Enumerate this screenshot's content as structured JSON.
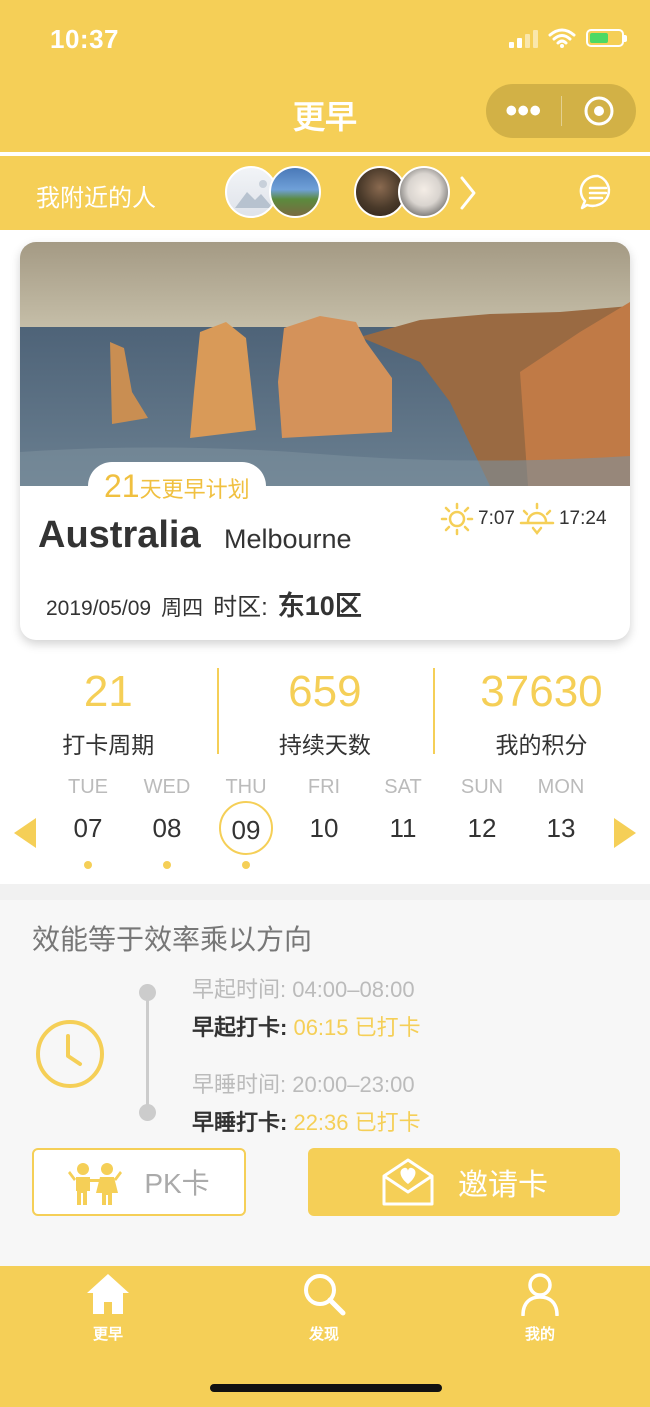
{
  "status": {
    "time": "10:37",
    "icons": [
      "signal-icon",
      "wifi-icon",
      "battery-charging-icon"
    ]
  },
  "nav": {
    "title": "更早",
    "capsule_more": "•••",
    "capsule_close_icon": "target-icon"
  },
  "nearby": {
    "label": "我附近的人"
  },
  "card": {
    "plan_number": "21",
    "plan_text": "天更早计划",
    "country": "Australia",
    "city": "Melbourne",
    "sunrise": "7:07",
    "sunset": "17:24",
    "date": "2019/05/09",
    "weekday": "周四",
    "tz_label": "时区:",
    "tz": "东10区"
  },
  "stats": [
    {
      "value": "21",
      "label": "打卡周期"
    },
    {
      "value": "659",
      "label": "持续天数"
    },
    {
      "value": "37630",
      "label": "我的积分"
    }
  ],
  "week": [
    {
      "name": "TUE",
      "num": "07",
      "dot": true,
      "selected": false
    },
    {
      "name": "WED",
      "num": "08",
      "dot": true,
      "selected": false
    },
    {
      "name": "THU",
      "num": "09",
      "dot": true,
      "selected": true
    },
    {
      "name": "FRI",
      "num": "10",
      "dot": false,
      "selected": false
    },
    {
      "name": "SAT",
      "num": "11",
      "dot": false,
      "selected": false
    },
    {
      "name": "SUN",
      "num": "12",
      "dot": false,
      "selected": false
    },
    {
      "name": "MON",
      "num": "13",
      "dot": false,
      "selected": false
    }
  ],
  "motto": "效能等于效率乘以方向",
  "schedule": {
    "early_range": "早起时间: 04:00–08:00",
    "early_label": "早起打卡: ",
    "early_value": "06:15 已打卡",
    "sleep_range": "早睡时间: 20:00–23:00",
    "sleep_label": "早睡打卡: ",
    "sleep_value": "22:36 已打卡"
  },
  "buttons": {
    "pk": "PK卡",
    "invite": "邀请卡"
  },
  "tabs": [
    {
      "label": "更早",
      "icon": "home-icon"
    },
    {
      "label": "发现",
      "icon": "search-icon"
    },
    {
      "label": "我的",
      "icon": "person-icon"
    }
  ],
  "colors": {
    "accent": "#f5cf57",
    "background": "#ffffff",
    "section": "#f7f7f7"
  }
}
